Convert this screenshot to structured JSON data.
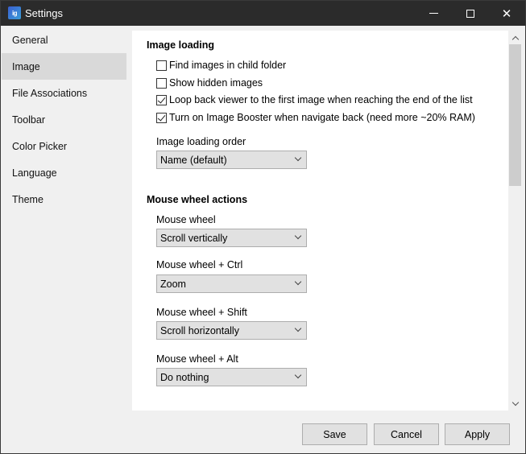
{
  "window": {
    "title": "Settings",
    "app_icon": "app-logo-icon",
    "app_icon_text": "ig",
    "controls": {
      "minimize": "minimize-icon",
      "maximize": "maximize-icon",
      "close": "close-icon",
      "close_glyph": "✕"
    }
  },
  "sidebar": {
    "selected": "Image",
    "items": [
      {
        "label": "General"
      },
      {
        "label": "Image"
      },
      {
        "label": "File Associations"
      },
      {
        "label": "Toolbar"
      },
      {
        "label": "Color Picker"
      },
      {
        "label": "Language"
      },
      {
        "label": "Theme"
      }
    ]
  },
  "image_loading": {
    "title": "Image loading",
    "options": [
      {
        "label": "Find images in child folder",
        "checked": false
      },
      {
        "label": "Show hidden images",
        "checked": false
      },
      {
        "label": "Loop back viewer to the first image when reaching the end of the list",
        "checked": true
      },
      {
        "label": "Turn on Image Booster when navigate back (need more ~20% RAM)",
        "checked": true
      }
    ],
    "order_label": "Image loading order",
    "order_value": "Name (default)"
  },
  "mouse_wheel": {
    "title": "Mouse wheel actions",
    "fields": [
      {
        "label": "Mouse wheel",
        "value": "Scroll vertically"
      },
      {
        "label": "Mouse wheel + Ctrl",
        "value": "Zoom"
      },
      {
        "label": "Mouse wheel + Shift",
        "value": "Scroll horizontally"
      },
      {
        "label": "Mouse wheel + Alt",
        "value": "Do nothing"
      }
    ]
  },
  "footer": {
    "save": "Save",
    "cancel": "Cancel",
    "apply": "Apply"
  }
}
